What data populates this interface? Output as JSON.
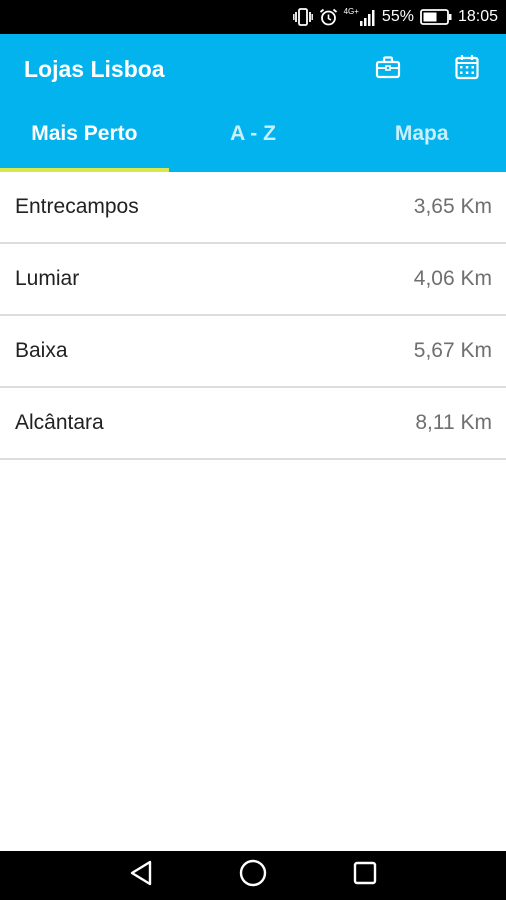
{
  "status_bar": {
    "network_label": "4G+",
    "battery_percent": "55%",
    "time": "18:05",
    "icons": [
      "vibrate-icon",
      "alarm-icon",
      "signal-icon",
      "battery-icon"
    ]
  },
  "app_bar": {
    "title": "Lojas Lisboa",
    "background_color": "#03b3ee",
    "actions": [
      "briefcase-icon",
      "calendar-icon"
    ]
  },
  "tabs": [
    {
      "label": "Mais Perto",
      "active": true
    },
    {
      "label": "A - Z",
      "active": false
    },
    {
      "label": "Mapa",
      "active": false
    }
  ],
  "tab_indicator_color": "#d8e84a",
  "stores": [
    {
      "name": "Entrecampos",
      "distance": "3,65 Km"
    },
    {
      "name": "Lumiar",
      "distance": "4,06 Km"
    },
    {
      "name": "Baixa",
      "distance": "5,67 Km"
    },
    {
      "name": "Alcântara",
      "distance": "8,11 Km"
    }
  ],
  "nav_bar": {
    "buttons": [
      "back-icon",
      "home-icon",
      "recents-icon"
    ]
  }
}
